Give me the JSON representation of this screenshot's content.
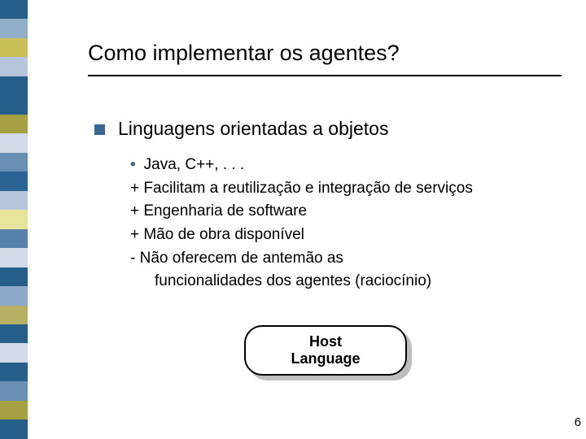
{
  "stripe_colors": [
    "#265e8a",
    "#90aec8",
    "#c9c05a",
    "#b7c6dc",
    "#265e8a",
    "#265e8a",
    "#a7a042",
    "#d1dae9",
    "#6a8fb4",
    "#2a6394",
    "#b7c6dc",
    "#e8e39a",
    "#5681ab",
    "#d1dae9",
    "#265e8a",
    "#8ea9c8",
    "#b7b064",
    "#265e8a",
    "#d1dae9",
    "#265e8a",
    "#6a8fb4",
    "#a7a042",
    "#265e8a"
  ],
  "title": "Como implementar os agentes?",
  "section": "Linguagens orientadas a objetos",
  "items": {
    "a": "•",
    "a_text": "Java, C++, . . .",
    "b": "+ Facilitam a reutilização e integração de serviços",
    "c": "+ Engenharia de software",
    "d": "+ Mão de obra disponível",
    "e": "- Não oferecem de antemão as",
    "e2": "funcionalidades dos agentes (raciocínio)"
  },
  "host": {
    "l1": "Host",
    "l2": "Language"
  },
  "page": "6"
}
